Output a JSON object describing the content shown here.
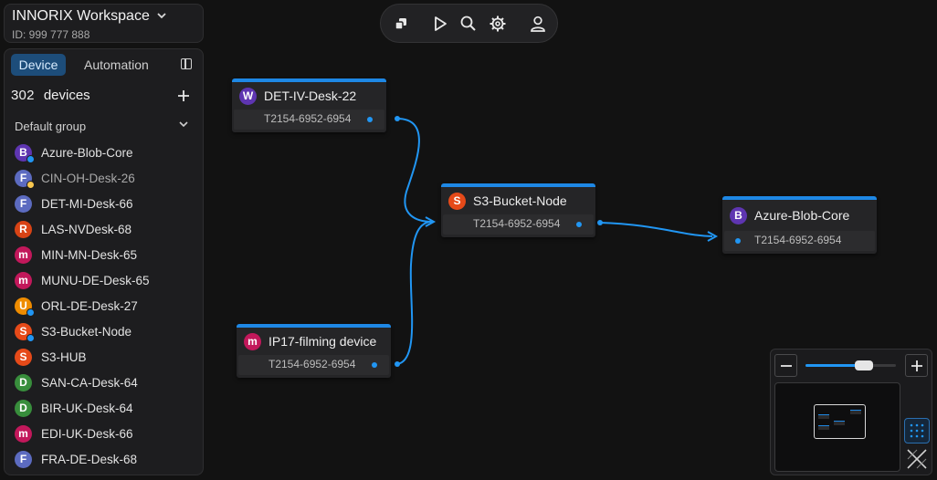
{
  "workspace": {
    "name": "INNORIX Workspace",
    "id_text": "ID: 999 777 888"
  },
  "sidebar": {
    "tabs": [
      {
        "label": "Device"
      },
      {
        "label": "Automation"
      }
    ],
    "device_count": "302",
    "devices_label": "devices",
    "group_label": "Default group",
    "items": [
      {
        "letter": "B",
        "label": "Azure-Blob-Core",
        "avatar_color": "#5e35b1",
        "status": "#2196f3",
        "dim": false
      },
      {
        "letter": "F",
        "label": "CIN-OH-Desk-26",
        "avatar_color": "#5c6bc0",
        "status": "#f9c74f",
        "dim": true
      },
      {
        "letter": "F",
        "label": "DET-MI-Desk-66",
        "avatar_color": "#5c6bc0",
        "status": "",
        "dim": false
      },
      {
        "letter": "R",
        "label": "LAS-NVDesk-68",
        "avatar_color": "#d84315",
        "status": "",
        "dim": false
      },
      {
        "letter": "m",
        "label": "MIN-MN-Desk-65",
        "avatar_color": "#c2185b",
        "status": "",
        "dim": false
      },
      {
        "letter": "m",
        "label": "MUNU-DE-Desk-65",
        "avatar_color": "#c2185b",
        "status": "",
        "dim": false
      },
      {
        "letter": "U",
        "label": "ORL-DE-Desk-27",
        "avatar_color": "#ef8c00",
        "status": "#2196f3",
        "dim": false
      },
      {
        "letter": "S",
        "label": "S3-Bucket-Node",
        "avatar_color": "#e64a19",
        "status": "#2196f3",
        "dim": false
      },
      {
        "letter": "S",
        "label": "S3-HUB",
        "avatar_color": "#e64a19",
        "status": "",
        "dim": false
      },
      {
        "letter": "D",
        "label": "SAN-CA-Desk-64",
        "avatar_color": "#388e3c",
        "status": "",
        "dim": false
      },
      {
        "letter": "D",
        "label": "BIR-UK-Desk-64",
        "avatar_color": "#388e3c",
        "status": "",
        "dim": false
      },
      {
        "letter": "m",
        "label": "EDI-UK-Desk-66",
        "avatar_color": "#c2185b",
        "status": "",
        "dim": false
      },
      {
        "letter": "F",
        "label": "FRA-DE-Desk-68",
        "avatar_color": "#5c6bc0",
        "status": "",
        "dim": false
      }
    ]
  },
  "canvas": {
    "nodes": [
      {
        "letter": "W",
        "title": "DET-IV-Desk-22",
        "id_text": "T2154-6952-6954",
        "avatar_color": "#5e35b1"
      },
      {
        "letter": "m",
        "title": "IP17-filming device",
        "id_text": "T2154-6952-6954",
        "avatar_color": "#c2185b"
      },
      {
        "letter": "S",
        "title": "S3-Bucket-Node",
        "id_text": "T2154-6952-6954",
        "avatar_color": "#e64a19"
      },
      {
        "letter": "B",
        "title": "Azure-Blob-Core",
        "id_text": "T2154-6952-6954",
        "avatar_color": "#5e35b1"
      }
    ]
  },
  "zoom": {
    "level": 0.65
  },
  "colors": {
    "accent": "#2196f3",
    "background": "#121212",
    "panel": "#1d1d1f"
  }
}
